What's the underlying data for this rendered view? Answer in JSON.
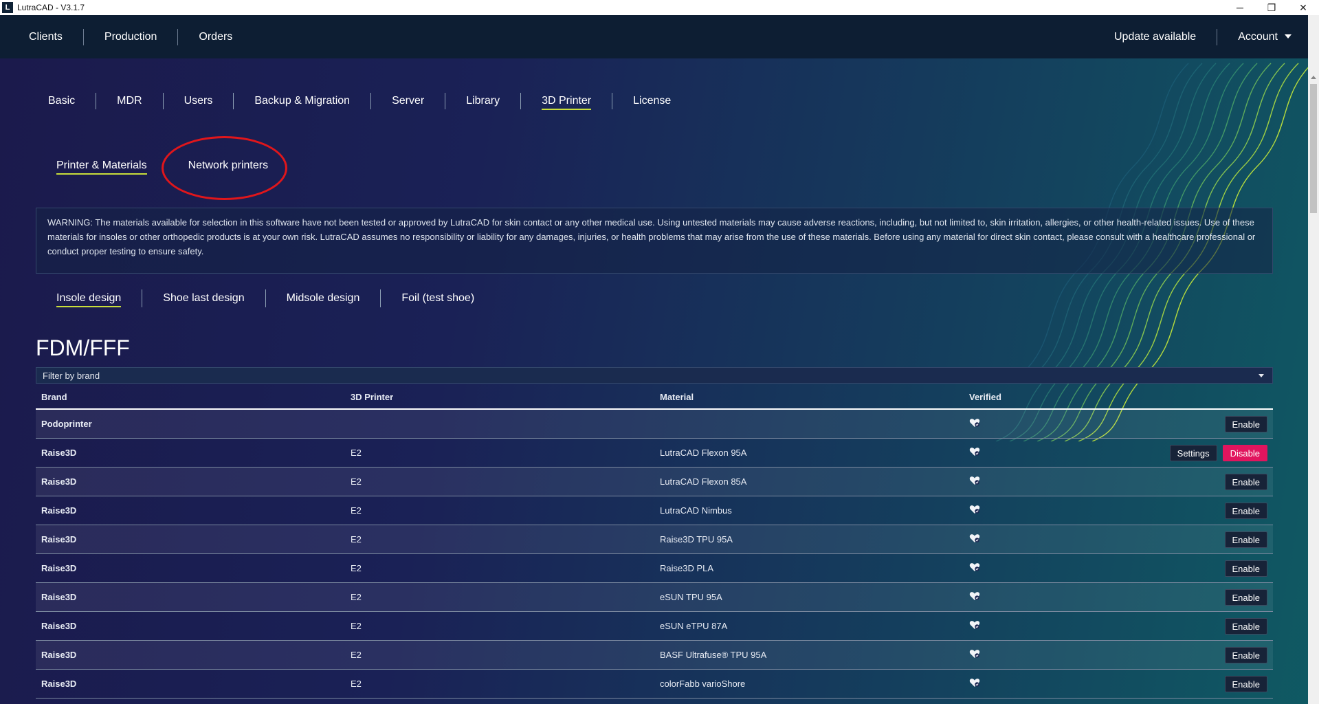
{
  "window": {
    "title": "LutraCAD - V3.1.7",
    "minimize": "─",
    "restore": "❐",
    "close": "✕"
  },
  "topnav": {
    "items": [
      "Clients",
      "Production",
      "Orders"
    ],
    "update": "Update available",
    "account": "Account"
  },
  "settings_tabs": [
    "Basic",
    "MDR",
    "Users",
    "Backup & Migration",
    "Server",
    "Library",
    "3D Printer",
    "License"
  ],
  "active_settings_tab": "3D Printer",
  "sub_tabs": {
    "printer_materials": "Printer & Materials",
    "network_printers": "Network printers"
  },
  "warning": "WARNING: The materials available for selection in this software have not been tested or approved by LutraCAD for skin contact or any other medical use. Using untested materials may cause adverse reactions, including, but not limited to, skin irritation, allergies, or other health-related issues. Use of these materials for insoles or other orthopedic products is at your own risk. LutraCAD assumes no responsibility or liability for any damages, injuries, or health problems that may arise from the use of these materials. Before using any material for direct skin contact, please consult with a healthcare professional or conduct proper testing to ensure safety.",
  "material_tabs": [
    "Insole design",
    "Shoe last design",
    "Midsole design",
    "Foil (test shoe)"
  ],
  "section_title": "FDM/FFF",
  "filter": {
    "placeholder": "Filter by brand"
  },
  "table": {
    "headers": {
      "brand": "Brand",
      "printer": "3D Printer",
      "material": "Material",
      "verified": "Verified"
    },
    "rows": [
      {
        "brand": "Podoprinter",
        "printer": "",
        "material": "",
        "enable": "Enable"
      },
      {
        "brand": "Raise3D",
        "printer": "E2",
        "material": "LutraCAD Flexon 95A",
        "settings": "Settings",
        "disable": "Disable"
      },
      {
        "brand": "Raise3D",
        "printer": "E2",
        "material": "LutraCAD Flexon 85A",
        "enable": "Enable"
      },
      {
        "brand": "Raise3D",
        "printer": "E2",
        "material": "LutraCAD Nimbus",
        "enable": "Enable"
      },
      {
        "brand": "Raise3D",
        "printer": "E2",
        "material": "Raise3D TPU 95A",
        "enable": "Enable"
      },
      {
        "brand": "Raise3D",
        "printer": "E2",
        "material": "Raise3D PLA",
        "enable": "Enable"
      },
      {
        "brand": "Raise3D",
        "printer": "E2",
        "material": "eSUN TPU 95A",
        "enable": "Enable"
      },
      {
        "brand": "Raise3D",
        "printer": "E2",
        "material": "eSUN eTPU 87A",
        "enable": "Enable"
      },
      {
        "brand": "Raise3D",
        "printer": "E2",
        "material": "BASF Ultrafuse® TPU 95A",
        "enable": "Enable"
      },
      {
        "brand": "Raise3D",
        "printer": "E2",
        "material": "colorFabb varioShore",
        "enable": "Enable"
      }
    ]
  },
  "icons": {
    "verified": "verified-heart-icon",
    "dropdown": "chevron-down-icon"
  },
  "colors": {
    "accent_underline": "#c9df3a",
    "disable_button": "#e1155e",
    "annotation_circle": "#e0161b"
  }
}
